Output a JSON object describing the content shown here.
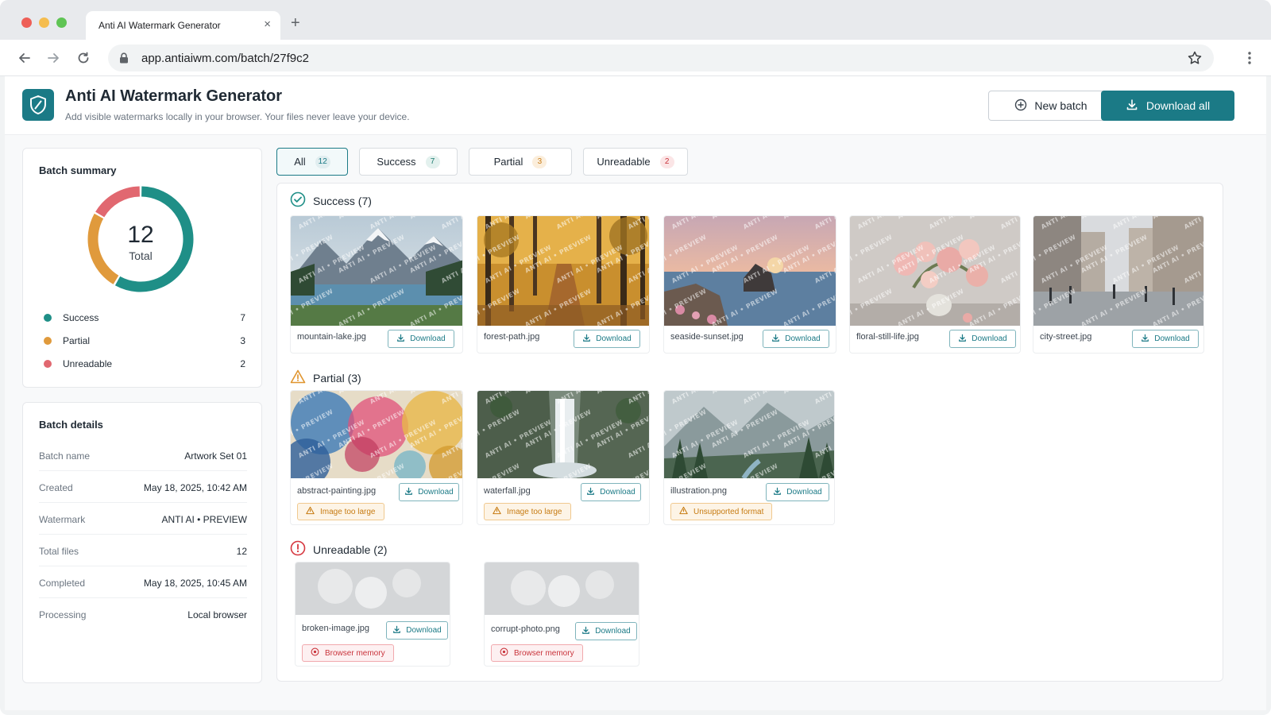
{
  "browser": {
    "tab_title": "Anti AI Watermark Generator",
    "url": "app.antiaiwm.com/batch/27f9c2"
  },
  "app": {
    "title": "Anti AI Watermark Generator",
    "subtitle": "Add visible watermarks locally in your browser. Your files never leave your device.",
    "new_batch_label": "New batch",
    "download_all_label": "Download all",
    "accent_color": "#1b7a86"
  },
  "summary": {
    "title": "Batch summary",
    "total": "12",
    "total_label": "Total",
    "chart_data": {
      "type": "pie",
      "categories": [
        "Success",
        "Partial",
        "Unreadable"
      ],
      "values": [
        7,
        3,
        2
      ],
      "colors": [
        "#1f8f87",
        "#e09a3c",
        "#e16870"
      ]
    },
    "legend": [
      {
        "label": "Success",
        "value": "7",
        "color": "#1f8f87"
      },
      {
        "label": "Partial",
        "value": "3",
        "color": "#e09a3c"
      },
      {
        "label": "Unreadable",
        "value": "2",
        "color": "#e16870"
      }
    ]
  },
  "details": {
    "title": "Batch details",
    "rows": [
      {
        "label": "Batch name",
        "value": "Artwork Set 01"
      },
      {
        "label": "Created",
        "value": "May 18, 2025, 10:42 AM"
      },
      {
        "label": "Watermark",
        "value": "ANTI AI • PREVIEW"
      },
      {
        "label": "Total files",
        "value": "12"
      },
      {
        "label": "Completed",
        "value": "May 18, 2025, 10:45 AM"
      },
      {
        "label": "Processing",
        "value": "Local browser"
      }
    ]
  },
  "filters": [
    {
      "label": "All",
      "count": "12"
    },
    {
      "label": "Success",
      "count": "7"
    },
    {
      "label": "Partial",
      "count": "3"
    },
    {
      "label": "Unreadable",
      "count": "2"
    }
  ],
  "sections": {
    "success": {
      "title": "Success (7)"
    },
    "partial": {
      "title": "Partial (3)"
    },
    "unreadable": {
      "title": "Unreadable (2)"
    }
  },
  "download_label": "Download",
  "watermark_text": "ANTI AI • PREVIEW",
  "files": {
    "success": [
      {
        "name": "mountain-lake.jpg"
      },
      {
        "name": "forest-path.jpg"
      },
      {
        "name": "seaside-sunset.jpg"
      },
      {
        "name": "floral-still-life.jpg"
      },
      {
        "name": "city-street.jpg"
      }
    ],
    "partial": [
      {
        "name": "abstract-painting.jpg",
        "issue": "Image too large"
      },
      {
        "name": "waterfall.jpg",
        "issue": "Image too large"
      },
      {
        "name": "illustration.png",
        "issue": "Unsupported format"
      }
    ],
    "unreadable": [
      {
        "name": "broken-image.jpg",
        "issue": "Browser memory"
      },
      {
        "name": "corrupt-photo.png",
        "issue": "Browser memory"
      }
    ]
  }
}
